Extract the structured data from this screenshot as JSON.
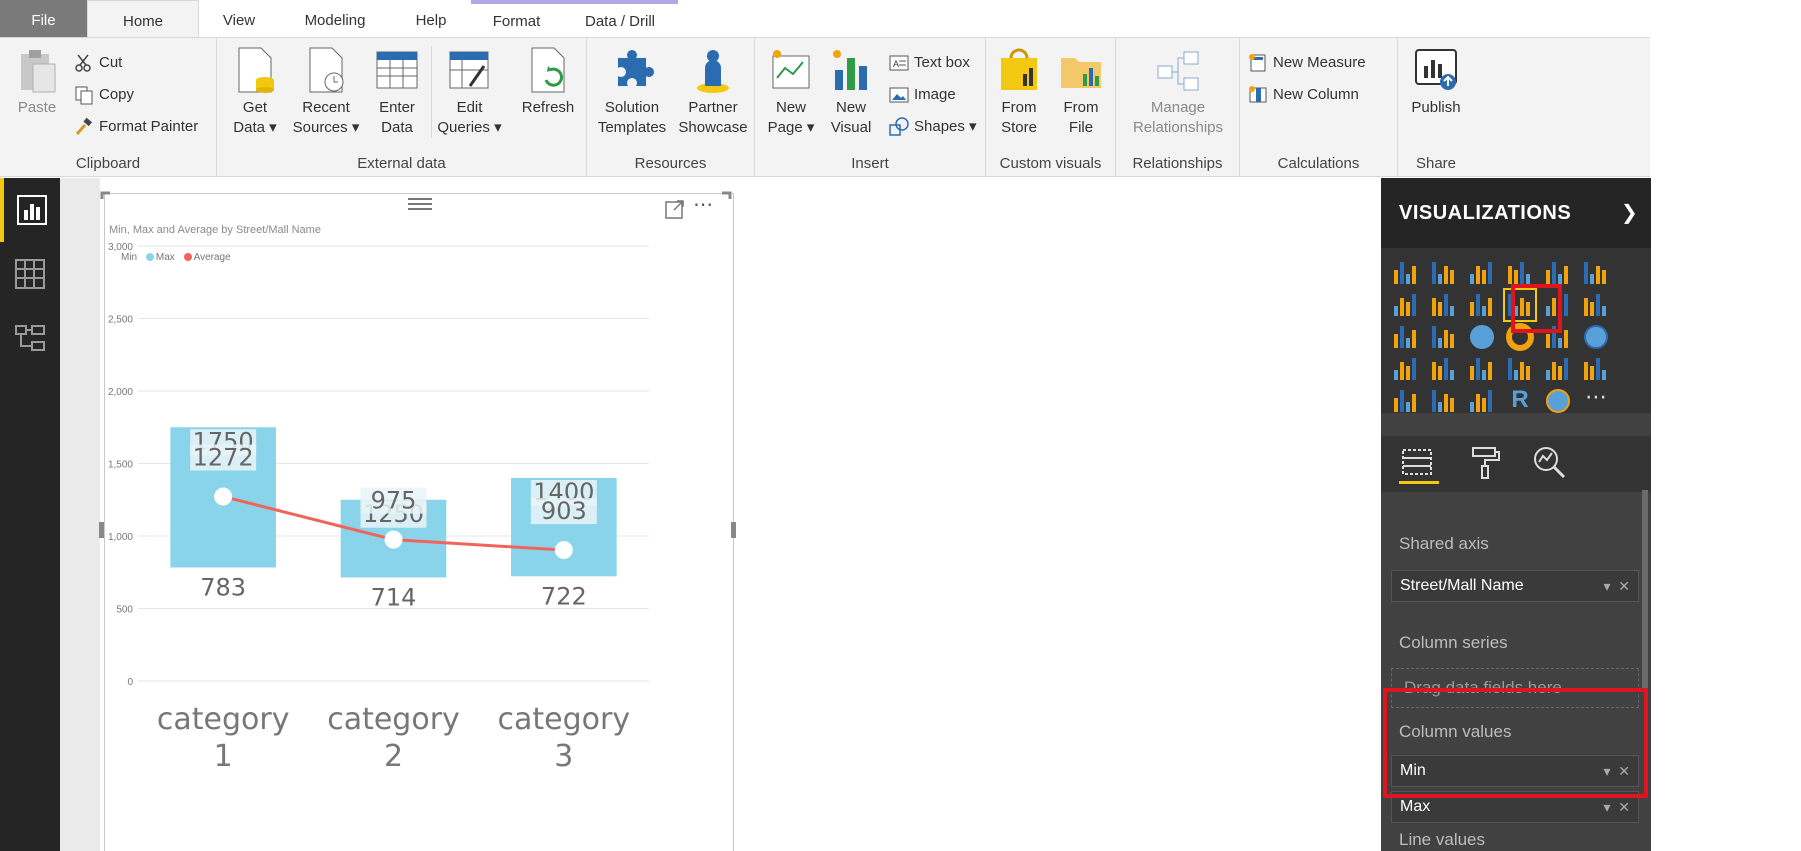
{
  "tabs": [
    "File",
    "Home",
    "View",
    "Modeling",
    "Help",
    "Format",
    "Data / Drill"
  ],
  "clipboard": {
    "paste": "Paste",
    "cut": "Cut",
    "copy": "Copy",
    "format_painter": "Format Painter",
    "label": "Clipboard"
  },
  "external_data": {
    "get_data": [
      "Get",
      "Data"
    ],
    "recent_sources": [
      "Recent",
      "Sources"
    ],
    "enter_data": [
      "Enter",
      "Data"
    ],
    "edit_queries": [
      "Edit",
      "Queries"
    ],
    "refresh": "Refresh",
    "label": "External data"
  },
  "resources": {
    "solution_templates": [
      "Solution",
      "Templates"
    ],
    "partner_showcase": [
      "Partner",
      "Showcase"
    ],
    "label": "Resources"
  },
  "insert": {
    "new_page": [
      "New",
      "Page"
    ],
    "new_visual": [
      "New",
      "Visual"
    ],
    "text_box": "Text box",
    "image": "Image",
    "shapes": "Shapes",
    "label": "Insert"
  },
  "custom_visuals": {
    "from_store": [
      "From",
      "Store"
    ],
    "from_file": [
      "From",
      "File"
    ],
    "label": "Custom visuals"
  },
  "relationships": {
    "manage": [
      "Manage",
      "Relationships"
    ],
    "label": "Relationships"
  },
  "calculations": {
    "new_measure": "New Measure",
    "new_column": "New Column",
    "label": "Calculations"
  },
  "share": {
    "publish": "Publish",
    "label": "Share"
  },
  "visual": {
    "title": "Min, Max and Average by Street/Mall Name",
    "legend": [
      {
        "name": "Min",
        "color": ""
      },
      {
        "name": "Max",
        "color": "#8ad4eb"
      },
      {
        "name": "Average",
        "color": "#f2645a"
      }
    ]
  },
  "chart_data": {
    "type": "bar",
    "title": "Min, Max and Average by Street/Mall Name",
    "categories": [
      "category 1",
      "category 2",
      "category 3"
    ],
    "series": [
      {
        "name": "Min",
        "values": [
          783,
          714,
          722
        ]
      },
      {
        "name": "Max",
        "values": [
          1750,
          1250,
          1400
        ]
      },
      {
        "name": "Average",
        "values": [
          1272,
          975,
          903
        ]
      }
    ],
    "y_ticks": [
      "0",
      "500",
      "1,000",
      "1,500",
      "2,000",
      "2,500",
      "3,000"
    ],
    "ylim": [
      0,
      3000
    ],
    "bar_color": "#8ad4eb",
    "line_color": "#f2645a",
    "grid": true,
    "legend_position": "top-left"
  },
  "visualizations": {
    "title": "VISUALIZATIONS",
    "shared_axis_label": "Shared axis",
    "shared_axis_field": "Street/Mall Name",
    "column_series_label": "Column series",
    "drop_placeholder": "Drag data fields here",
    "column_values_label": "Column values",
    "column_values": [
      "Min",
      "Max"
    ],
    "line_values_label": "Line values",
    "more_glyph": "⋯",
    "expand_glyph": "❯"
  }
}
